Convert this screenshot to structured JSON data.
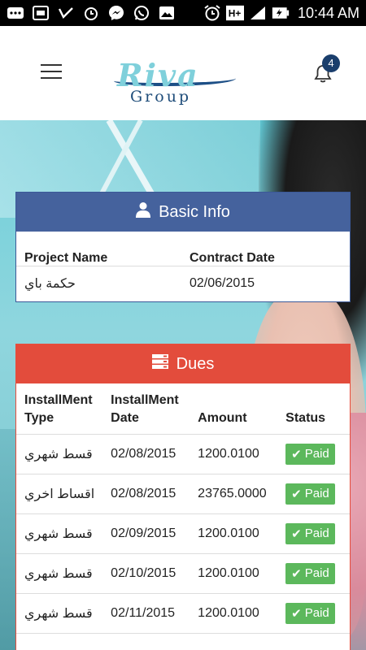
{
  "status_bar": {
    "time": "10:44 AM",
    "network": "H+",
    "left_icons": [
      "more-icon",
      "screen-icon",
      "check-icon",
      "alarm-icon",
      "messenger-icon",
      "whatsapp-icon",
      "image-icon"
    ],
    "right_icons": [
      "alarm-icon",
      "network-type-icon",
      "signal-icon",
      "battery-charging-icon"
    ]
  },
  "header": {
    "logo_main": "Riva",
    "logo_sub": "Group",
    "notification_count": "4",
    "icons": {
      "menu": "hamburger-menu-icon",
      "notifications": "bell-icon"
    }
  },
  "basic_info": {
    "title": "Basic Info",
    "icon": "user-icon",
    "header_color": "#45629d",
    "columns": [
      "Project Name",
      "Contract Date"
    ],
    "row": {
      "project_name": "حكمة باي",
      "contract_date": "02/06/2015"
    }
  },
  "dues": {
    "title": "Dues",
    "icon": "server-icon",
    "header_color": "#e34c3c",
    "columns": {
      "type": "InstallMent Type",
      "type_line1": "InstallMent",
      "type_line2": "Type",
      "date": "InstallMent Date",
      "date_line1": "InstallMent",
      "date_line2": "Date",
      "amount": "Amount",
      "status": "Status"
    },
    "rows": [
      {
        "type": "قسط شهري",
        "date": "02/08/2015",
        "amount": "1200.0100",
        "status": "Paid"
      },
      {
        "type": "اقساط اخري",
        "date": "02/08/2015",
        "amount": "23765.0000",
        "status": "Paid"
      },
      {
        "type": "قسط شهري",
        "date": "02/09/2015",
        "amount": "1200.0100",
        "status": "Paid"
      },
      {
        "type": "قسط شهري",
        "date": "02/10/2015",
        "amount": "1200.0100",
        "status": "Paid"
      },
      {
        "type": "قسط شهري",
        "date": "02/11/2015",
        "amount": "1200.0100",
        "status": "Paid"
      }
    ],
    "status_color": "#5cb85c"
  }
}
